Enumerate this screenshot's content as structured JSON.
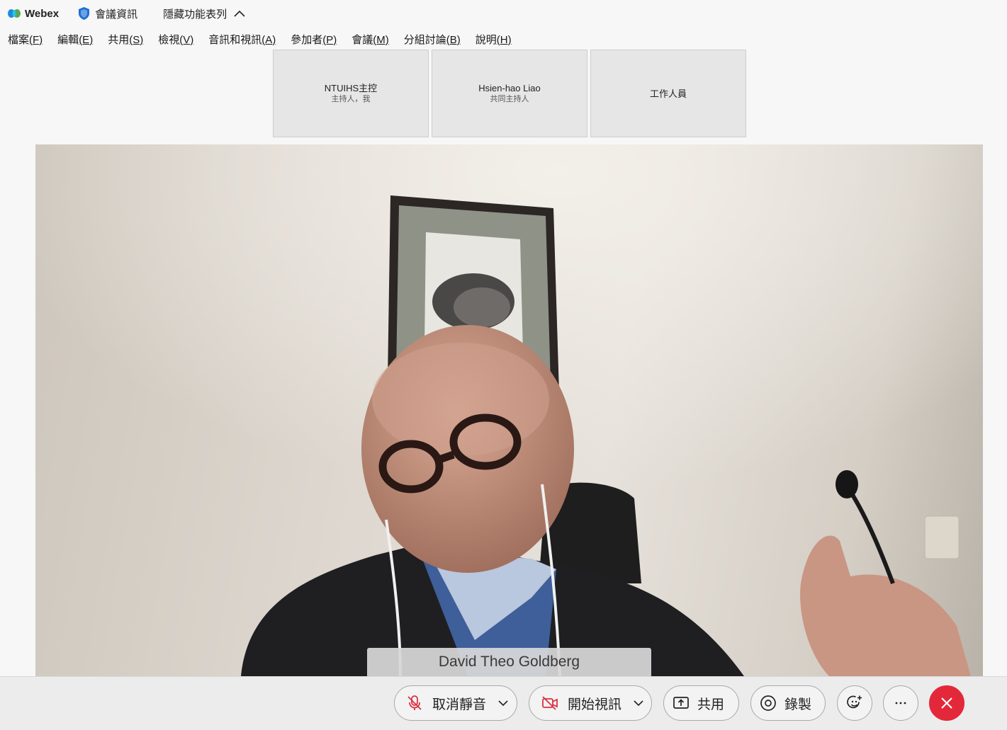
{
  "titlebar": {
    "app_name": "Webex",
    "logo_icon": "webex-logo-icon",
    "meeting_info_label": "會議資訊",
    "meeting_info_icon": "shield-icon",
    "hide_menu_label": "隱藏功能表列",
    "hide_menu_icon": "chevron-up-icon"
  },
  "menubar": {
    "items": [
      {
        "label": "檔案",
        "key": "(F)"
      },
      {
        "label": "編輯",
        "key": "(E)"
      },
      {
        "label": "共用",
        "key": "(S)"
      },
      {
        "label": "檢視",
        "key": "(V)"
      },
      {
        "label": "音訊和視訊",
        "key": "(A)"
      },
      {
        "label": "參加者",
        "key": "(P)"
      },
      {
        "label": "會議",
        "key": "(M)"
      },
      {
        "label": "分組討論",
        "key": "(B)"
      },
      {
        "label": "說明",
        "key": "(H)"
      }
    ]
  },
  "participants": [
    {
      "name": "NTUIHS主控",
      "role": "主持人，我"
    },
    {
      "name": "Hsien-hao Liao",
      "role": "共同主持人"
    },
    {
      "name": "工作人員",
      "role": ""
    }
  ],
  "video": {
    "speaker_name": "David Theo Goldberg"
  },
  "controls": {
    "mute_label": "取消靜音",
    "video_label": "開始視訊",
    "share_label": "共用",
    "record_label": "錄製",
    "icons": {
      "mute": "microphone-muted-icon",
      "video": "camera-off-icon",
      "share": "share-icon",
      "record": "record-icon",
      "reactions": "reactions-icon",
      "more": "more-icon",
      "leave": "close-icon"
    },
    "leave_color": "#e3283a"
  }
}
